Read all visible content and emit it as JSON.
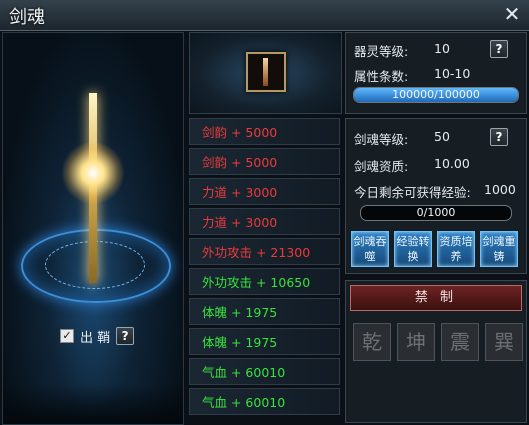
{
  "window": {
    "title": "剑魂",
    "close_label": "✕"
  },
  "scene": {
    "checkbox_label": "出 鞘",
    "checkbox_checked": true,
    "help_label": "?"
  },
  "attributes": [
    {
      "text": "剑韵 + 5000",
      "color": "red"
    },
    {
      "text": "剑韵 + 5000",
      "color": "red"
    },
    {
      "text": "力道 + 3000",
      "color": "red"
    },
    {
      "text": "力道 + 3000",
      "color": "red"
    },
    {
      "text": "外功攻击 + 21300",
      "color": "red"
    },
    {
      "text": "外功攻击 + 10650",
      "color": "green"
    },
    {
      "text": "体魄 + 1975",
      "color": "green"
    },
    {
      "text": "体魄 + 1975",
      "color": "green"
    },
    {
      "text": "气血 + 60010",
      "color": "green"
    },
    {
      "text": "气血 + 60010",
      "color": "green"
    }
  ],
  "spirit": {
    "level_label": "器灵等级:",
    "level_value": "10",
    "count_label": "属性条数:",
    "count_value": "10-10",
    "bar_text": "100000/100000",
    "bar_fraction": 1.0,
    "help_label": "?"
  },
  "soul": {
    "level_label": "剑魂等级:",
    "level_value": "50",
    "aptitude_label": "剑魂资质:",
    "aptitude_value": "10.00",
    "exp_label": "今日剩余可获得经验:",
    "exp_value": "1000",
    "bar_text": "0/1000",
    "bar_fraction": 0.0,
    "help_label": "?",
    "buttons": [
      "剑魂吞噬",
      "经验转换",
      "资质培养",
      "剑魂重铸"
    ]
  },
  "forbid": {
    "title": "禁 制",
    "trigrams": [
      "乾",
      "坤",
      "震",
      "巽"
    ]
  },
  "colors": {
    "red": "#ea3b3b",
    "green": "#39e23e",
    "accent_blue": "#2d7fc2",
    "forbid_red": "#6d2323"
  }
}
